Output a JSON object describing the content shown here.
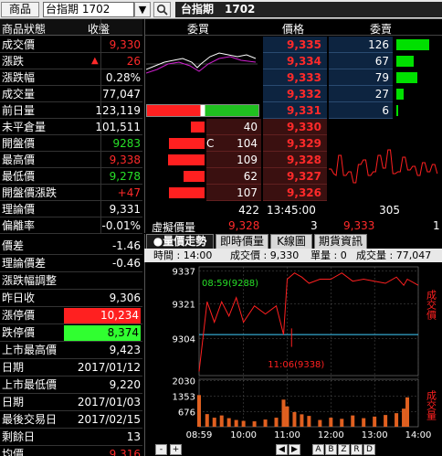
{
  "topbar": {
    "menu_label": "商品",
    "symbol_value": "台指期 1702",
    "dropdown_icon": "chevron-down-icon",
    "search_icon": "search-icon",
    "title": "台指期　1702"
  },
  "quote_header": {
    "label": "商品狀態",
    "value": "收盤"
  },
  "quote_rows": [
    {
      "label": "成交價",
      "value": "9,330",
      "color": "#ff2a2a"
    },
    {
      "label": "漲跌",
      "value": "26",
      "arrow": "▲",
      "color": "#ff2a2a"
    },
    {
      "label": "漲跌幅",
      "value": "0.28%",
      "color": "#ffffff"
    },
    {
      "label": "成交量",
      "value": "77,047",
      "color": "#ffffff"
    },
    {
      "label": "前日量",
      "value": "123,119",
      "color": "#ffffff"
    },
    {
      "label": "未平倉量",
      "value": "101,511",
      "color": "#ffffff"
    },
    {
      "label": "開盤價",
      "value": "9283",
      "color": "#28e028"
    },
    {
      "label": "最高價",
      "value": "9,338",
      "color": "#ff2a2a"
    },
    {
      "label": "最低價",
      "value": "9,278",
      "color": "#28e028"
    },
    {
      "label": "開盤價漲跌",
      "value": "+47",
      "color": "#ff2a2a"
    },
    {
      "label": "理論價",
      "value": "9,331",
      "color": "#ffffff"
    },
    {
      "label": "偏離率",
      "value": "-0.01%",
      "color": "#ffffff"
    }
  ],
  "orderbook": {
    "headers": {
      "bid": "委買",
      "price": "價格",
      "ask": "委賣"
    },
    "asks": [
      {
        "price": "9,335",
        "qty": "126",
        "bar": 1.0
      },
      {
        "price": "9,334",
        "qty": "67",
        "bar": 0.53
      },
      {
        "price": "9,333",
        "qty": "79",
        "bar": 0.63
      },
      {
        "price": "9,332",
        "qty": "27",
        "bar": 0.21
      },
      {
        "price": "9,331",
        "qty": "6",
        "bar": 0.05
      }
    ],
    "bids": [
      {
        "price": "9,330",
        "qty": "40",
        "tag": "",
        "bar": 0.37
      },
      {
        "price": "9,329",
        "qty": "104",
        "tag": "C",
        "bar": 0.97
      },
      {
        "price": "9,328",
        "qty": "109",
        "tag": "",
        "bar": 1.0
      },
      {
        "price": "9,327",
        "qty": "62",
        "tag": "",
        "bar": 0.57
      },
      {
        "price": "9,326",
        "qty": "107",
        "tag": "",
        "bar": 0.98
      }
    ],
    "summary": {
      "bid_total": "422",
      "time": "13:45:00",
      "ask_total": "305"
    },
    "virtual": {
      "label": "虛擬價量",
      "price1": "9,328",
      "qty": "3",
      "price2": "9,333",
      "qty2": "1"
    }
  },
  "lower_rows": [
    {
      "label": "價差",
      "value": "-1.46",
      "color": "#ffffff"
    },
    {
      "label": "理論價差",
      "value": "-0.46",
      "color": "#ffffff"
    },
    {
      "label": "漲跌幅調整",
      "value": "",
      "color": "#ffffff"
    },
    {
      "label": "昨日收",
      "value": "9,306",
      "color": "#ffffff"
    },
    {
      "label": "漲停價",
      "value": "10,234",
      "color": "#ffffff",
      "bg": "#ff2020"
    },
    {
      "label": "跌停價",
      "value": "8,374",
      "color": "#000000",
      "bg": "#30ff30"
    },
    {
      "label": "上市最高價",
      "value": "9,423",
      "color": "#ffffff"
    },
    {
      "label": "日期",
      "value": "2017/01/12",
      "color": "#ffffff"
    },
    {
      "label": "上市最低價",
      "value": "9,220",
      "color": "#ffffff"
    },
    {
      "label": "日期",
      "value": "2017/01/03",
      "color": "#ffffff"
    },
    {
      "label": "最後交易日",
      "value": "2017/02/15",
      "color": "#ffffff"
    },
    {
      "label": "剩餘日",
      "value": "13",
      "color": "#ffffff"
    },
    {
      "label": "均價",
      "value": "9,316",
      "color": "#ff2a2a"
    }
  ],
  "tabs": [
    {
      "label": "●量價走勢",
      "active": true
    },
    {
      "label": "即時價量",
      "active": false
    },
    {
      "label": "K線圖",
      "active": false
    },
    {
      "label": "期貨資訊",
      "active": false
    }
  ],
  "chart_info": {
    "time": "時間 : 14:00",
    "price": "成交價 : 9,330",
    "unit": "單量 : 0",
    "volume": "成交量 : 77,047"
  },
  "chart_data": {
    "type": "line",
    "price_ticks": [
      "9337",
      "9321",
      "9304"
    ],
    "volume_ticks": [
      "2030",
      "1353",
      "676"
    ],
    "x_ticks": [
      "08:59",
      "10:00",
      "11:00",
      "12:00",
      "13:00",
      "14:00"
    ],
    "price_axis_label": "成交價",
    "volume_axis_label": "成交量",
    "reference_price": 9306,
    "annotations": [
      {
        "text": "08:59(9288)"
      },
      {
        "text": "11:06(9338)"
      }
    ],
    "x": [
      "08:59",
      "09:10",
      "09:20",
      "09:30",
      "09:40",
      "09:50",
      "10:00",
      "10:15",
      "10:30",
      "10:45",
      "10:55",
      "11:00",
      "11:10",
      "11:20",
      "11:30",
      "11:45",
      "12:00",
      "12:15",
      "12:30",
      "12:45",
      "13:00",
      "13:15",
      "13:30",
      "13:40",
      "13:45",
      "14:00"
    ],
    "price": [
      9288,
      9322,
      9312,
      9322,
      9315,
      9324,
      9312,
      9320,
      9316,
      9320,
      9306,
      9333,
      9336,
      9334,
      9331,
      9333,
      9333,
      9336,
      9332,
      9333,
      9332,
      9331,
      9334,
      9330,
      9333,
      9330
    ],
    "volume": [
      1400,
      560,
      400,
      500,
      380,
      300,
      260,
      240,
      320,
      400,
      1200,
      900,
      650,
      550,
      480,
      300,
      400,
      350,
      500,
      380,
      450,
      520,
      600,
      800,
      1300,
      0
    ]
  },
  "bottom_buttons": [
    "-",
    "+",
    "◀",
    "▶",
    "A",
    "B",
    "Z",
    "R",
    "D"
  ],
  "colors": {
    "up": "#ff2a2a",
    "down": "#28e028",
    "ask_bar": "#00e000",
    "bid_bar": "#ff2020"
  }
}
